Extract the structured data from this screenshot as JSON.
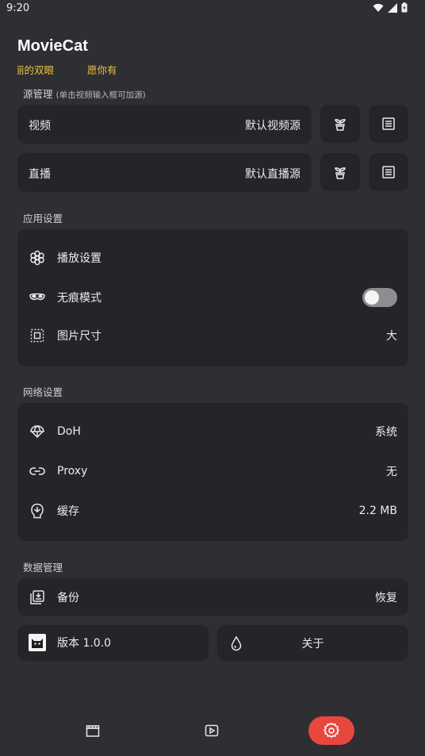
{
  "status_bar": {
    "time": "9:20"
  },
  "header": {
    "app_title": "MovieCat",
    "marquee_left": "丽的双眼",
    "marquee_right": "愿你有"
  },
  "source_section": {
    "title": "源管理",
    "hint": "(单击视频输入框可加源)",
    "video": {
      "label": "视频",
      "value": "默认视频源"
    },
    "live": {
      "label": "直播",
      "value": "默认直播源"
    }
  },
  "app_settings": {
    "title": "应用设置",
    "items": [
      {
        "label": "播放设置",
        "icon": "flower-icon"
      },
      {
        "label": "无痕模式",
        "icon": "mask-icon",
        "toggle_on": false
      },
      {
        "label": "图片尺寸",
        "icon": "image-size-icon",
        "value": "大"
      }
    ]
  },
  "network_settings": {
    "title": "网络设置",
    "items": [
      {
        "label": "DoH",
        "icon": "umbrella-icon",
        "value": "系统"
      },
      {
        "label": "Proxy",
        "icon": "link-icon",
        "value": "无"
      },
      {
        "label": "缓存",
        "icon": "cache-icon",
        "value": "2.2 MB"
      }
    ]
  },
  "data_management": {
    "title": "数据管理",
    "backup_label": "备份",
    "restore_label": "恢复",
    "version_label": "版本 1.0.0",
    "about_label": "关于"
  },
  "bottom_nav": {
    "items": [
      "movie-icon",
      "play-icon",
      "settings-icon"
    ],
    "active": 2,
    "active_color": "#e8473e"
  },
  "colors": {
    "background": "#2e2e33",
    "card": "#252529",
    "accent": "#e8473e",
    "marquee": "#e8c240"
  }
}
